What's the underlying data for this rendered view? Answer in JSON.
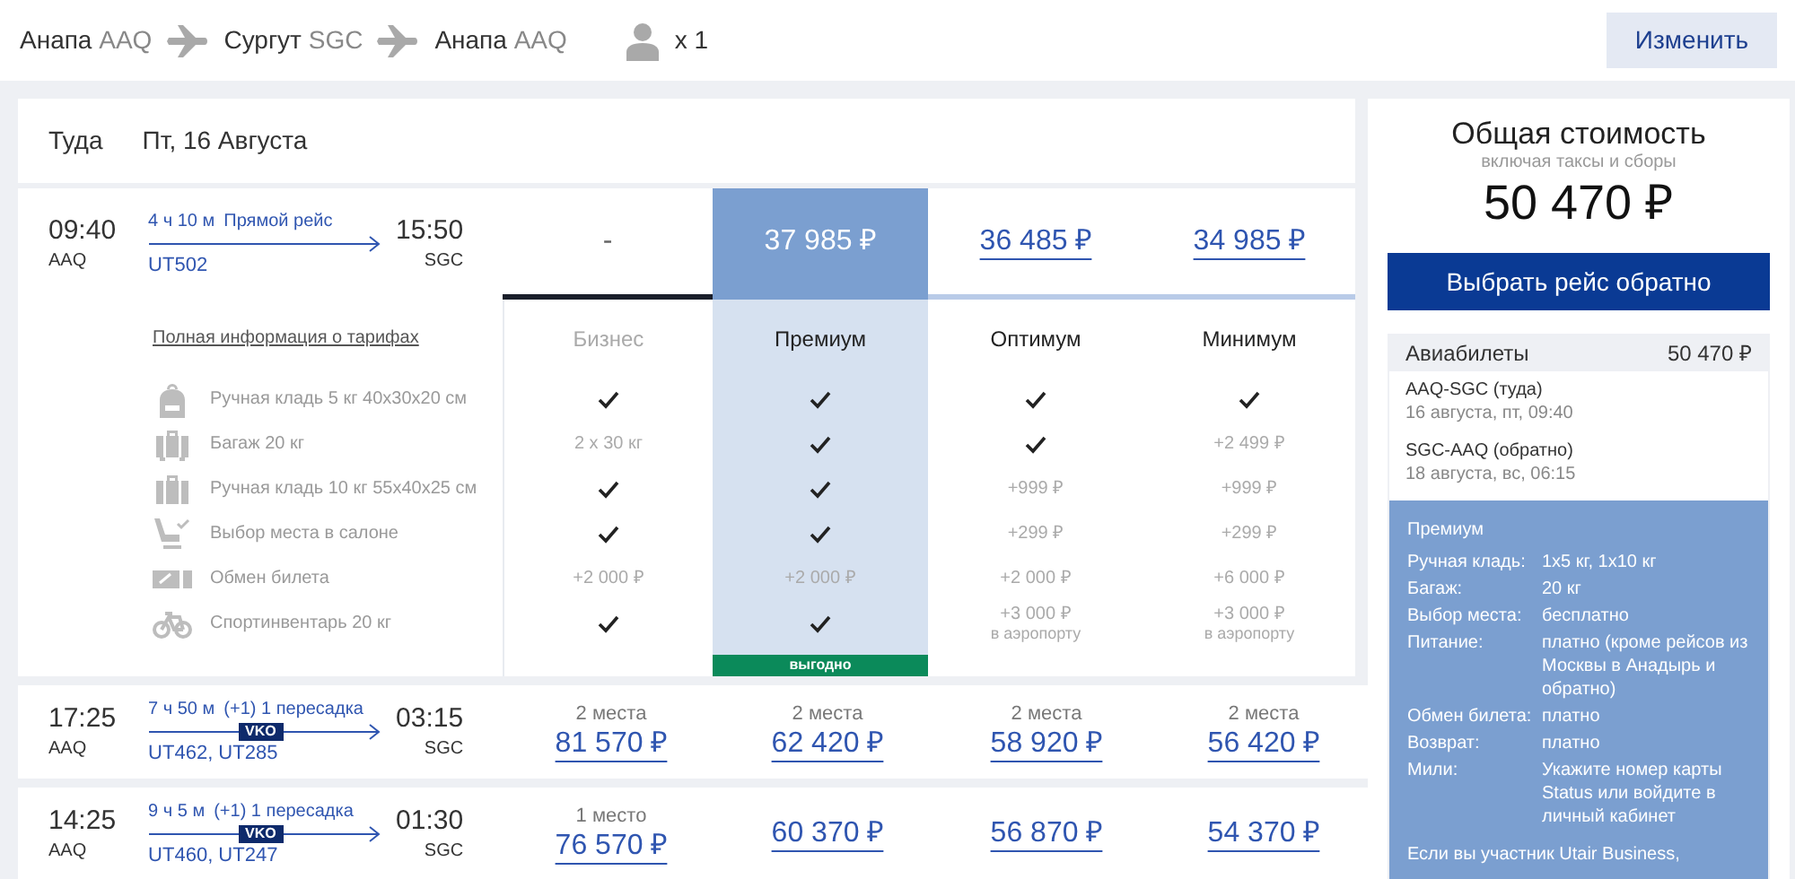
{
  "route": [
    {
      "city": "Анапа",
      "code": "AAQ"
    },
    {
      "city": "Сургут",
      "code": "SGC"
    },
    {
      "city": "Анапа",
      "code": "AAQ"
    }
  ],
  "passengers": "x 1",
  "change_button": "Изменить",
  "outbound": {
    "direction": "Туда",
    "date": "Пт, 16 Августа"
  },
  "flights": [
    {
      "dep_time": "09:40",
      "dep_code": "AAQ",
      "duration": "4 ч 10 м",
      "note": "Прямой рейс",
      "flight_numbers": "UT502",
      "arr_time": "15:50",
      "arr_code": "SGC",
      "fares": [
        {
          "price": "-",
          "available": false,
          "selected": false
        },
        {
          "price": "37 985 ₽",
          "available": true,
          "selected": true
        },
        {
          "price": "36 485 ₽",
          "available": true,
          "selected": false
        },
        {
          "price": "34 985 ₽",
          "available": true,
          "selected": false
        }
      ]
    },
    {
      "dep_time": "17:25",
      "dep_code": "AAQ",
      "duration": "7 ч 50 м",
      "note": "(+1) 1 пересадка",
      "stop": "VKO",
      "flight_numbers": "UT462, UT285",
      "arr_time": "03:15",
      "arr_code": "SGC",
      "fares": [
        {
          "seats": "2 места",
          "price": "81 570 ₽",
          "available": true,
          "selected": false
        },
        {
          "seats": "2 места",
          "price": "62 420 ₽",
          "available": true,
          "selected": false
        },
        {
          "seats": "2 места",
          "price": "58 920 ₽",
          "available": true,
          "selected": false
        },
        {
          "seats": "2 места",
          "price": "56 420 ₽",
          "available": true,
          "selected": false
        }
      ]
    },
    {
      "dep_time": "14:25",
      "dep_code": "AAQ",
      "duration": "9 ч 5 м",
      "note": "(+1) 1 пересадка",
      "stop": "VKO",
      "flight_numbers": "UT460, UT247",
      "arr_time": "01:30",
      "arr_code": "SGC",
      "fares": [
        {
          "seats": "1 место",
          "price": "76 570 ₽",
          "available": true,
          "selected": false
        },
        {
          "price": "60 370 ₽",
          "available": true,
          "selected": false
        },
        {
          "price": "56 870 ₽",
          "available": true,
          "selected": false
        },
        {
          "price": "54 370 ₽",
          "available": true,
          "selected": false
        }
      ]
    }
  ],
  "tariffs": {
    "info_link": "Полная информация о тарифах",
    "columns": [
      {
        "name": "Бизнес",
        "available": false,
        "selected": false
      },
      {
        "name": "Премиум",
        "available": true,
        "selected": true,
        "badge": "выгодно"
      },
      {
        "name": "Оптимум",
        "available": true,
        "selected": false
      },
      {
        "name": "Минимум",
        "available": true,
        "selected": false
      }
    ],
    "features": [
      {
        "kind": "backpack",
        "label": "Ручная кладь 5 кг 40x30x20 см",
        "values": [
          {
            "kind": "check"
          },
          {
            "kind": "check"
          },
          {
            "kind": "check"
          },
          {
            "kind": "check"
          }
        ]
      },
      {
        "kind": "suitcase",
        "label": "Багаж 20 кг",
        "values": [
          {
            "kind": "text",
            "text": "2 х 30 кг"
          },
          {
            "kind": "check"
          },
          {
            "kind": "check"
          },
          {
            "kind": "text",
            "text": "+2 499 ₽"
          }
        ]
      },
      {
        "kind": "briefcase",
        "label": "Ручная кладь 10 кг 55x40x25 см",
        "values": [
          {
            "kind": "check"
          },
          {
            "kind": "check"
          },
          {
            "kind": "text",
            "text": "+999 ₽"
          },
          {
            "kind": "text",
            "text": "+999 ₽"
          }
        ]
      },
      {
        "kind": "seat",
        "label": "Выбор места в салоне",
        "values": [
          {
            "kind": "check"
          },
          {
            "kind": "check"
          },
          {
            "kind": "text",
            "text": "+299 ₽"
          },
          {
            "kind": "text",
            "text": "+299 ₽"
          }
        ]
      },
      {
        "kind": "ticket",
        "label": "Обмен билета",
        "values": [
          {
            "kind": "text",
            "text": "+2 000 ₽"
          },
          {
            "kind": "text",
            "text": "+2 000 ₽"
          },
          {
            "kind": "text",
            "text": "+2 000 ₽"
          },
          {
            "kind": "text",
            "text": "+6 000 ₽"
          }
        ]
      },
      {
        "kind": "bike",
        "label": "Спортинвентарь 20 кг",
        "values": [
          {
            "kind": "check"
          },
          {
            "kind": "check"
          },
          {
            "kind": "text",
            "text": "+3 000 ₽",
            "note": "в аэропорту"
          },
          {
            "kind": "text",
            "text": "+3 000 ₽",
            "note": "в аэропорту"
          }
        ]
      }
    ]
  },
  "summary": {
    "title": "Общая стоимость",
    "subtitle": "включая таксы и сборы",
    "total": "50 470 ₽",
    "button": "Выбрать рейс обратно",
    "tickets": {
      "label": "Авиабилеты",
      "price": "50 470 ₽",
      "legs": [
        {
          "route": "AAQ-SGC (туда)",
          "date": "16 августа, пт, 09:40"
        },
        {
          "route": "SGC-AAQ (обратно)",
          "date": "18 августа, вс, 06:15"
        }
      ]
    },
    "fare_details": {
      "name": "Премиум",
      "rows": [
        {
          "label": "Ручная кладь:",
          "value": "1x5 кг, 1x10 кг"
        },
        {
          "label": "Багаж:",
          "value": "20 кг"
        },
        {
          "label": "Выбор места:",
          "value": "бесплатно"
        },
        {
          "label": "Питание:",
          "value": "платно (кроме рейсов из Москвы в Анадырь и обратно)"
        },
        {
          "label": "Обмен билета:",
          "value": "платно"
        },
        {
          "label": "Возврат:",
          "value": "платно"
        },
        {
          "label": "Мили:",
          "value": "Укажите номер карты Status или войдите в личный кабинет"
        }
      ],
      "note": "Если вы участник Utair Business,"
    }
  }
}
